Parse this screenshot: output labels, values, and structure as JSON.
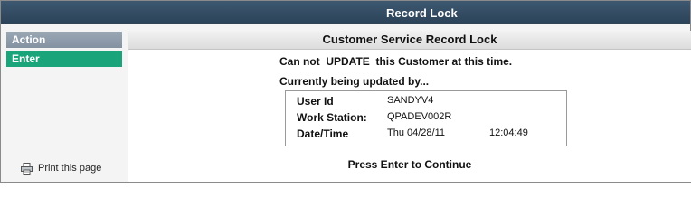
{
  "window": {
    "title": "Record Lock"
  },
  "sidebar": {
    "header": "Action",
    "items": [
      {
        "label": "Enter"
      }
    ],
    "print_link": {
      "label": "Print this page",
      "icon": "printer-icon"
    }
  },
  "main": {
    "title": "Customer Service Record Lock",
    "line1": "Can not  UPDATE  this Customer at this time.",
    "line2": "Currently being updated by...",
    "lock_info": {
      "user_id_label": "User Id",
      "user_id": "SANDYV4",
      "workstation_label": "Work Station:",
      "workstation": "QPADEV002R",
      "datetime_label": "Date/Time",
      "date": "Thu 04/28/11",
      "time": "12:04:49"
    },
    "instruction": "Press Enter to Continue"
  },
  "colors": {
    "titlebar": "#2f4a61",
    "action_header": "#8e9cab",
    "enter_item": "#1aa47a"
  }
}
